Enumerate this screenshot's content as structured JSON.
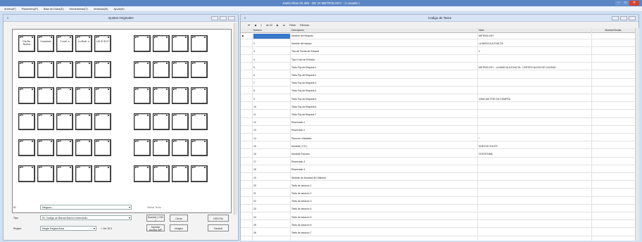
{
  "window": {
    "title": "Justin Elias 02.455 - DE 24 METROLOGY - ( Licuado )"
  },
  "menu": [
    "Archivo(F)",
    "Parametros(P)",
    "Base de Datos(D)",
    "Herramientas(T)",
    "Ventanas(W)",
    "Ayuda(H)"
  ],
  "left_panel": {
    "title": "Ajustes Originales",
    "buttons_top": [
      "Dis.Bs. Nuevo",
      "Comando",
      "T.corti. e",
      "Ls.Borb. e",
      "UK ID B 07"
    ],
    "controls": {
      "id_label": "ID",
      "id_value": "Ninguno",
      "tipo_label": "Tipo",
      "tipo_value": "ID: Codigo de Barras Basi en intermedio",
      "region_label": "Region",
      "region_value": "Single Region/Area",
      "option_label": "Ver ID 0",
      "salvar_label": "Salvar Texto",
      "guardar_label": "Guardar ( CSV )",
      "cerrar_label": "Cerrar",
      "importar_label": "Importar Archivo IMP",
      "imagen_label": "Imagen",
      "ok_label": "ODS File",
      "general_label": "General"
    }
  },
  "right_panel": {
    "title": "Codigo de Tarea",
    "toolbar": [
      "⏮",
      "◀",
      "1",
      "de 22",
      "▶",
      "⏭",
      "Filtrar",
      "Eliminar"
    ],
    "columns": [
      "Numero",
      "Descripcion",
      "Valor",
      "Mostrar/Ocultar"
    ],
    "rows": [
      {
        "n": "1",
        "desc": "Nombre del Negocio",
        "val": "METROLOGY",
        "chk": true
      },
      {
        "n": "2",
        "desc": "Nombre del equipo",
        "val": "LA BASCULA EXACTA",
        "chk": true
      },
      {
        "n": "3",
        "desc": "Tipo de Fecha de Entrada",
        "val": "1",
        "chk": false
      },
      {
        "n": "4",
        "desc": "Tipo Codo de Entrada",
        "val": "",
        "chk": false
      },
      {
        "n": "5",
        "desc": "Texto Fijo de Etiqueta 1",
        "val": "METROLOGY - LA BASCULA EXACTA - CERTIFICACION DE CALIDAD",
        "chk": true
      },
      {
        "n": "6",
        "desc": "Texto Fijo de Etiqueta 2",
        "val": "",
        "chk": false
      },
      {
        "n": "7",
        "desc": "Texto Fijo de Etiqueta 3",
        "val": "",
        "chk": false
      },
      {
        "n": "8",
        "desc": "Texto Fijo de Etiqueta 4",
        "val": "",
        "chk": false
      },
      {
        "n": "9",
        "desc": "Texto Fijo de Etiqueta 5",
        "val": "GRACIAS POR SU COMPRA",
        "chk": true
      },
      {
        "n": "10",
        "desc": "Texto Fijo de Etiqueta 6",
        "val": "",
        "chk": false
      },
      {
        "n": "11",
        "desc": "Texto Fijo de Etiqueta 7",
        "val": "",
        "chk": false
      },
      {
        "n": "12",
        "desc": "Reservado 1",
        "val": "",
        "chk": false
      },
      {
        "n": "13",
        "desc": "Reservado 2",
        "val": "",
        "chk": false
      },
      {
        "n": "14",
        "desc": "Placa en Unidades",
        "val": "*",
        "chk": false
      },
      {
        "n": "15",
        "desc": "Moneda ( CO )",
        "val": "NUEVOS SOLES",
        "chk": false
      },
      {
        "n": "16",
        "desc": "Moneda Fraccion",
        "val": "CENTESIMA",
        "chk": false
      },
      {
        "n": "17",
        "desc": "Reservado 3",
        "val": "",
        "chk": false
      },
      {
        "n": "18",
        "desc": "Reservado 4",
        "val": "",
        "chk": false
      },
      {
        "n": "19",
        "desc": "Simbolo de Moneda del Sistema",
        "val": "",
        "chk": false
      },
      {
        "n": "20",
        "desc": "Texto de anuncio 1",
        "val": "",
        "chk": false
      },
      {
        "n": "21",
        "desc": "Texto de anuncio 2",
        "val": "",
        "chk": false
      },
      {
        "n": "22",
        "desc": "Texto de anuncio 3",
        "val": "",
        "chk": false
      },
      {
        "n": "23",
        "desc": "Texto de anuncio 4",
        "val": "",
        "chk": false
      },
      {
        "n": "24",
        "desc": "Texto de anuncio 5",
        "val": "",
        "chk": false
      },
      {
        "n": "25",
        "desc": "Texto de anuncio 6",
        "val": "",
        "chk": false
      },
      {
        "n": "26",
        "desc": "Texto de anuncio 7",
        "val": "",
        "chk": false
      }
    ]
  },
  "colors": {
    "titlebar": "#5b86c4",
    "selected_cell": "#3a78c9",
    "close": "#d9432f"
  }
}
